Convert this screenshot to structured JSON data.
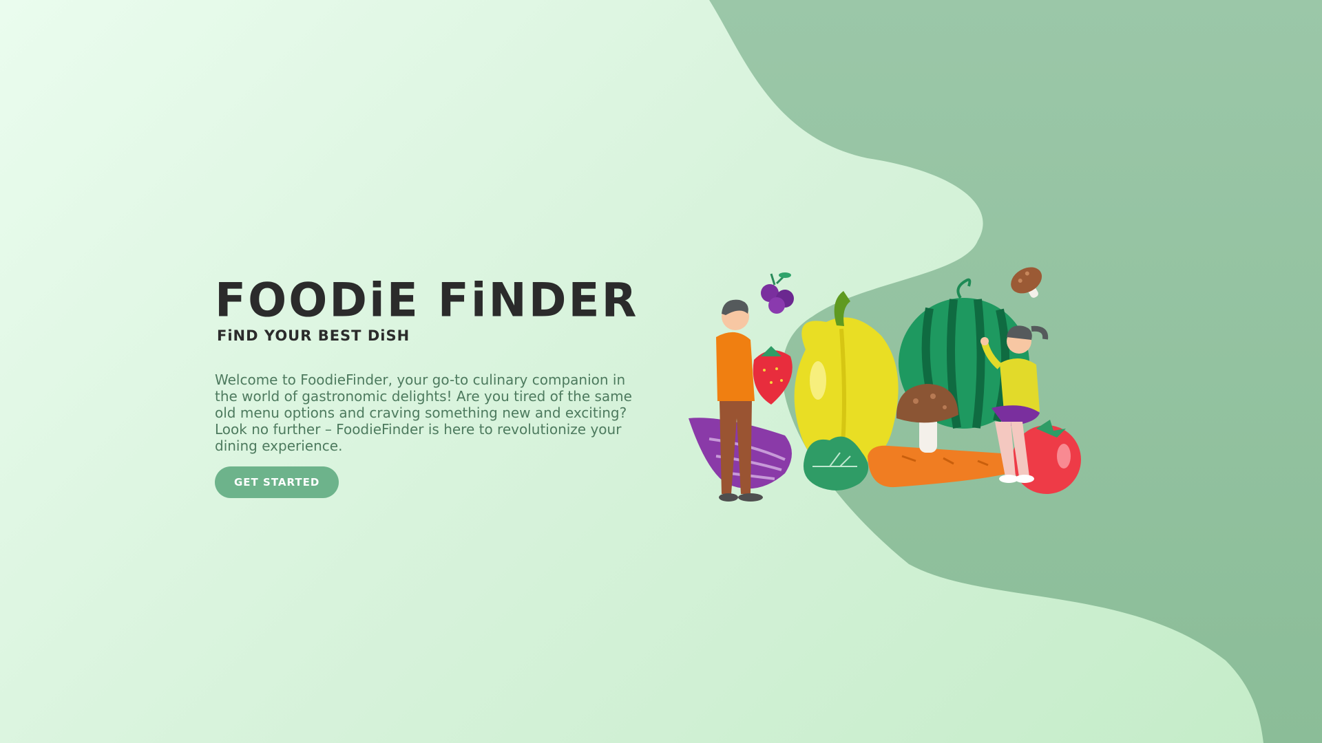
{
  "hero": {
    "title": "FOODiE FiNDER",
    "tagline": "FiND YOUR BEST DiSH",
    "description": "Welcome to FoodieFinder, your go-to culinary companion in the world of gastronomic delights! Are you tired of the same old menu options and craving something new and exciting? Look no further – FoodieFinder is here to revolutionize your dining experience.",
    "cta_label": "GET STARTED"
  },
  "illustration": {
    "icon": "people-with-vegetables-illustration"
  },
  "colors": {
    "background_light": "#eafcee",
    "background_wave": "#97c4a5",
    "heading_text": "#2b2b2b",
    "body_text": "#4d7a5e",
    "button": "#6db38b"
  }
}
